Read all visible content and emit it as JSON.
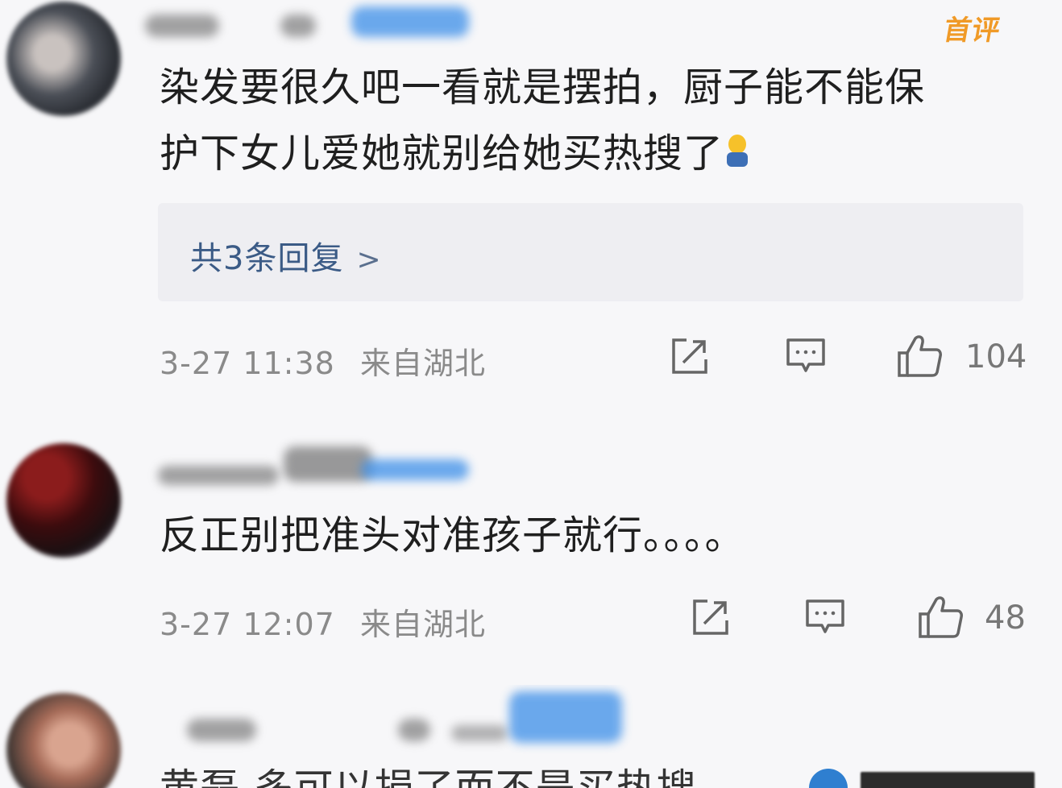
{
  "comments": [
    {
      "badge": "首评",
      "text_line1": "染发要很久吧一看就是摆拍，厨子能不能保",
      "text_line2": "护下女儿爱她就别给她买热搜了",
      "replies_label": "共3条回复",
      "time": "3-27 11:38",
      "location": "来自湖北",
      "likes": "104"
    },
    {
      "text": "反正别把准头对准孩子就行。。。。",
      "time": "3-27 12:07",
      "location": "来自湖北",
      "likes": "48"
    },
    {
      "text_partial": "黄磊 多可以捐了而不是买热搜"
    }
  ],
  "icons": {
    "share": "share-icon",
    "comment": "comment-icon",
    "like": "thumbs-up-icon",
    "chevron": "chevron-right-icon"
  },
  "colors": {
    "badge": "#f09a27",
    "reply_link": "#3b5b86",
    "meta": "#8a8a8a"
  }
}
